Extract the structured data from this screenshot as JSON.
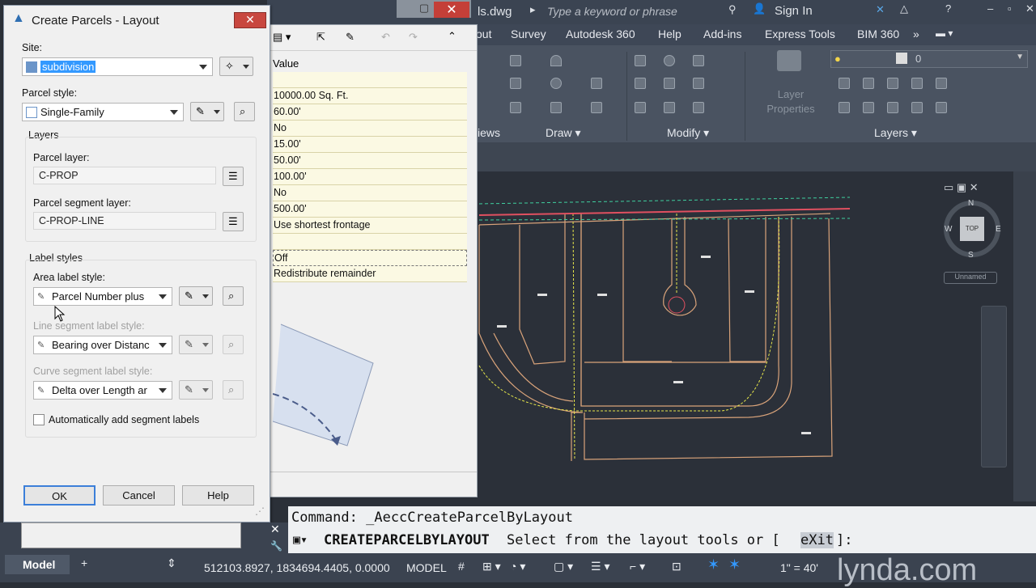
{
  "app": {
    "file_title": "ls.dwg",
    "search_placeholder": "Type a keyword or phrase",
    "sign_in": "Sign In",
    "ribbon_tabs": [
      "out",
      "Survey",
      "Autodesk 360",
      "Help",
      "Add-ins",
      "Express Tools",
      "BIM 360"
    ],
    "panel_labels": {
      "views": "iews",
      "draw": "Draw",
      "modify": "Modify",
      "layers": "Layers",
      "layer_properties": "Layer Properties"
    },
    "layer_current": "0",
    "viewcube": {
      "top": "TOP",
      "north": "N",
      "south": "S",
      "east": "E",
      "west": "W",
      "ucs": "Unnamed"
    }
  },
  "palette": {
    "value_header": "Value",
    "values": [
      "",
      "10000.00 Sq. Ft.",
      "60.00'",
      "No",
      "15.00'",
      "50.00'",
      "100.00'",
      "No",
      "500.00'",
      "Use shortest frontage",
      "",
      "Off",
      "Redistribute remainder"
    ]
  },
  "dialog": {
    "title": "Create Parcels - Layout",
    "site_label": "Site:",
    "site_value": "subdivision",
    "parcel_style_label": "Parcel style:",
    "parcel_style_value": "Single-Family",
    "layers_group": "Layers",
    "parcel_layer_label": "Parcel layer:",
    "parcel_layer_value": "C-PROP",
    "segment_layer_label": "Parcel segment layer:",
    "segment_layer_value": "C-PROP-LINE",
    "label_styles_group": "Label styles",
    "area_label_label": "Area label style:",
    "area_label_value": "Parcel Number plus",
    "line_seg_label": "Line segment label style:",
    "line_seg_value": "Bearing over Distanc",
    "curve_seg_label": "Curve segment label style:",
    "curve_seg_value": "Delta over Length ar",
    "auto_add_label": "Automatically add segment labels",
    "ok": "OK",
    "cancel": "Cancel",
    "help": "Help"
  },
  "command": {
    "history": "Command: _AeccCreateParcelByLayout",
    "prompt_cmd": "CREATEPARCELBYLAYOUT",
    "prompt_text": "Select from the layout tools or [",
    "prompt_option": "eXit",
    "prompt_end": "]:"
  },
  "status": {
    "model_tab": "Model",
    "coords": "512103.8927, 1834694.4405, 0.0000",
    "model": "MODEL",
    "scale": "1\" = 40'",
    "watermark": "lynda.com"
  },
  "colors": {
    "accent": "#3399ff",
    "viewport_bg": "#2b3039",
    "parcel_line": "#d9a37a",
    "road_yellow": "#e6e64a",
    "row_yellow": "#fbf9e3"
  }
}
